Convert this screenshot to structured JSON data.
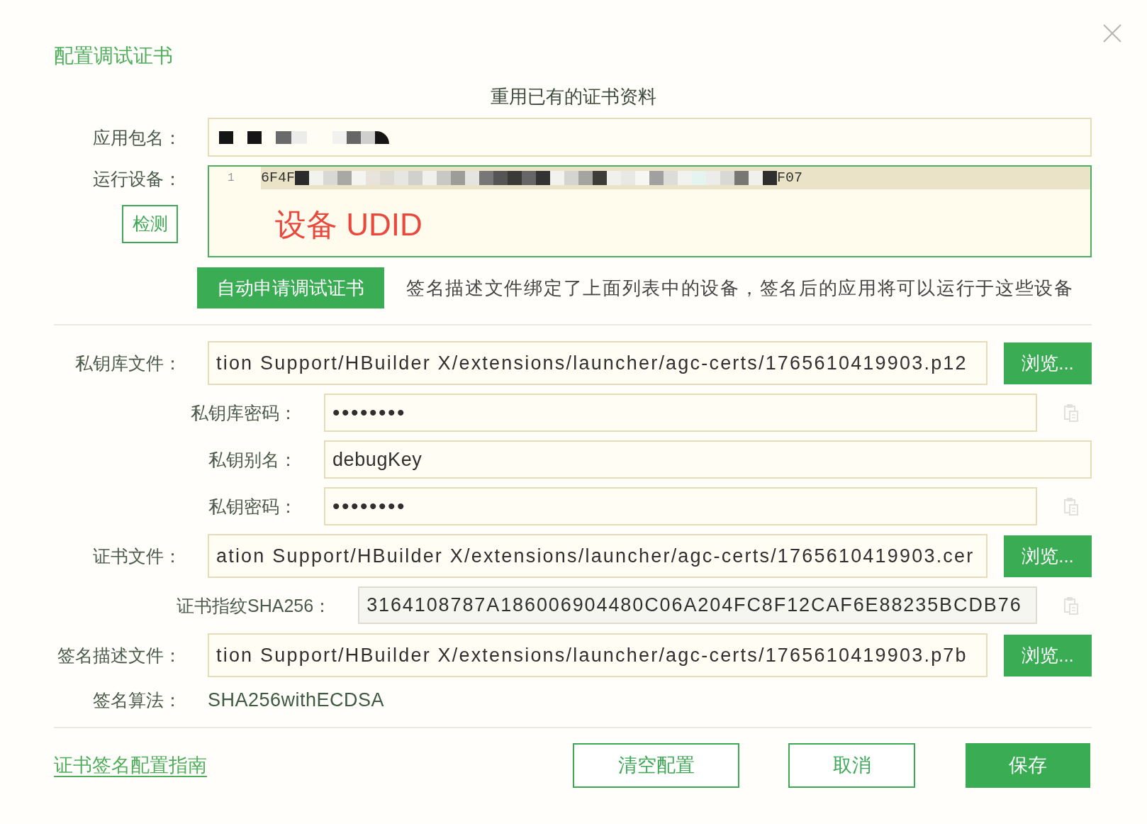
{
  "dialog": {
    "title": "配置调试证书",
    "section_title": "重用已有的证书资料"
  },
  "package_row": {
    "label": "应用包名："
  },
  "device_row": {
    "label": "运行设备：",
    "detect_button": "检测",
    "line_number": "1",
    "line_start": "6F4F",
    "line_end": "F07",
    "annotation": "设备 UDID"
  },
  "auto_apply": {
    "button": "自动申请调试证书",
    "note": "签名描述文件绑定了上面列表中的设备，签名后的应用将可以运行于这些设备"
  },
  "fields": [
    {
      "kind": "file",
      "label": "私钥库文件：",
      "value": "tion Support/HBuilder X/extensions/launcher/agc-certs/1765610419903.p12",
      "button": "浏览..."
    },
    {
      "kind": "password",
      "label": "私钥库密码：",
      "value": "••••••••"
    },
    {
      "kind": "text",
      "label": "私钥别名：",
      "value": "debugKey"
    },
    {
      "kind": "password",
      "label": "私钥密码：",
      "value": "••••••••"
    },
    {
      "kind": "file",
      "label": "证书文件：",
      "value": "ation Support/HBuilder X/extensions/launcher/agc-certs/1765610419903.cer",
      "button": "浏览..."
    },
    {
      "kind": "readonly",
      "label": "证书指纹SHA256：",
      "value": "3164108787A186006904480C06A204FC8F12CAF6E88235BCDB76"
    },
    {
      "kind": "file",
      "label": "签名描述文件：",
      "value": "tion Support/HBuilder X/extensions/launcher/agc-certs/1765610419903.p7b",
      "button": "浏览..."
    },
    {
      "kind": "static",
      "label": "签名算法：",
      "value": "SHA256withECDSA"
    }
  ],
  "footer": {
    "guide_link": "证书签名配置指南",
    "buttons": [
      {
        "label": "清空配置",
        "kind": "outline"
      },
      {
        "label": "取消",
        "kind": "outline"
      },
      {
        "label": "保存",
        "kind": "primary"
      }
    ]
  }
}
